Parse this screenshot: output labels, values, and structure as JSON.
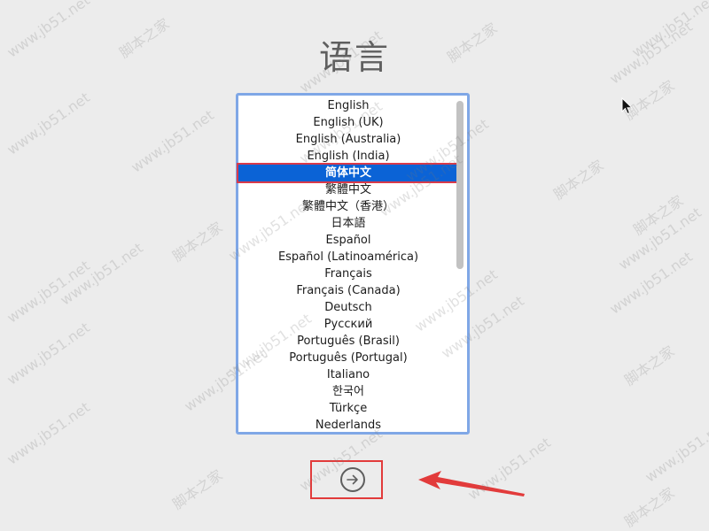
{
  "title": "语言",
  "languages": [
    "English",
    "English (UK)",
    "English (Australia)",
    "English (India)",
    "简体中文",
    "繁體中文",
    "繁體中文（香港）",
    "日本語",
    "Español",
    "Español (Latinoamérica)",
    "Français",
    "Français (Canada)",
    "Deutsch",
    "Русский",
    "Português (Brasil)",
    "Português (Portugal)",
    "Italiano",
    "한국어",
    "Türkçe",
    "Nederlands"
  ],
  "selected_index": 4,
  "watermarks": {
    "cn": "脚本之家",
    "en": "www.jb51.net"
  },
  "colors": {
    "selection": "#0b63d6",
    "highlight_box": "#e23b3b",
    "list_border": "#7fa7e6"
  },
  "icons": {
    "next": "arrow-right-circle-icon",
    "cursor": "mouse-pointer-icon",
    "annotation": "red-arrow-annotation"
  }
}
